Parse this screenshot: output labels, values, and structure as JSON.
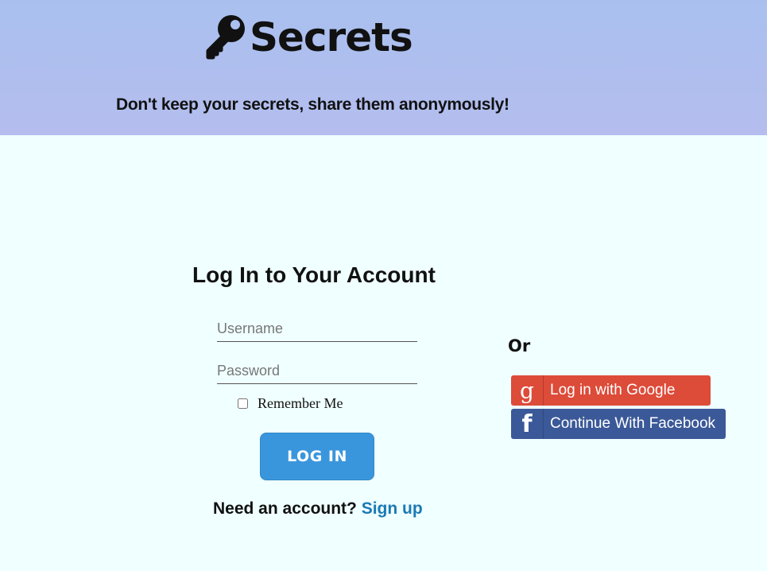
{
  "header": {
    "brand": "Secrets",
    "tagline": "Don't keep your secrets, share them anonymously!"
  },
  "login": {
    "title": "Log In to Your Account",
    "username_placeholder": "Username",
    "password_placeholder": "Password",
    "remember_label": "Remember Me",
    "login_button": "LOG IN",
    "need_account": "Need an account?",
    "signup_link": "Sign up"
  },
  "social": {
    "or_label": "Or",
    "google": {
      "icon": "google-icon",
      "label": "Log in with Google",
      "color": "#dd4b39"
    },
    "facebook": {
      "icon": "facebook-icon",
      "label": "Continue With Facebook",
      "color": "#3b5998"
    }
  },
  "colors": {
    "header_bg": "#abc0ef",
    "page_bg": "#f0ffff",
    "primary_button": "#3a96dc",
    "link": "#1a7ab5"
  }
}
